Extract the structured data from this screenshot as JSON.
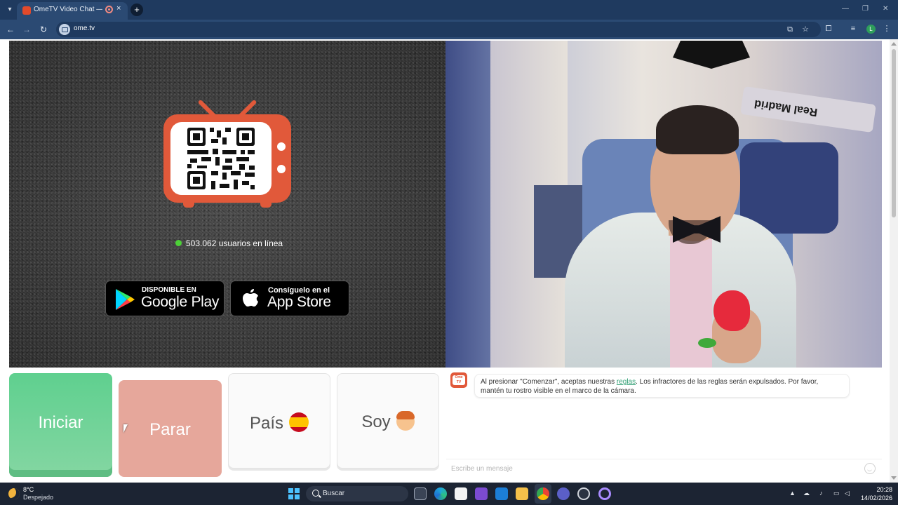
{
  "browser": {
    "tab_title": "OmeTV Video Chat — Ome",
    "tab_close": "×",
    "new_tab": "+",
    "url": "ome.tv",
    "profile_initial": "L"
  },
  "page": {
    "online_count": "503.062 usuarios en línea",
    "google_play": {
      "small": "DISPONIBLE EN",
      "big": "Google Play"
    },
    "app_store": {
      "small": "Consíguelo en el",
      "big": "App Store"
    },
    "remote_video": {
      "scarf_text": "Real Madrid"
    }
  },
  "controls": {
    "start": "Iniciar",
    "stop": "Parar",
    "country": "País",
    "gender": "Soy"
  },
  "chat": {
    "logo": "Ome TV",
    "message_before": "Al presionar \"Comenzar\", aceptas nuestras ",
    "rules_link": "reglas",
    "message_after": ". Los infractores de las reglas serán expulsados. Por favor, mantén tu rostro visible en el marco de la cámara.",
    "input_placeholder": "Escribe un mensaje"
  },
  "taskbar": {
    "weather_temp": "8°C",
    "weather_desc": "Despejado",
    "search_label": "Buscar",
    "time": "20:28",
    "date": "14/02/2026"
  },
  "colors": {
    "accent_green": "#5fd08f",
    "stop_salmon": "#e6a79b",
    "ome_orange": "#e1593a",
    "online_dot": "#4cd137"
  }
}
